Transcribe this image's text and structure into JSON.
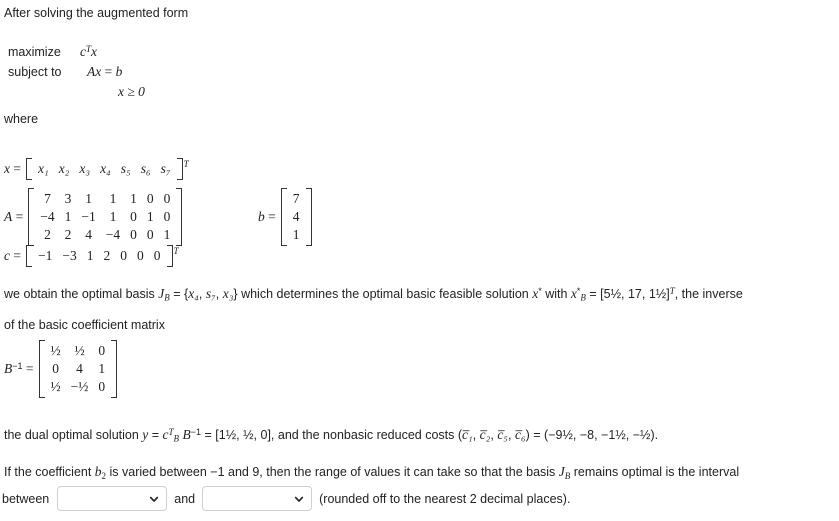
{
  "intro": "After solving the augmented form",
  "problem": {
    "maximize_label": "maximize",
    "maximize_expr_c": "c",
    "maximize_expr_T": "T",
    "maximize_expr_x": "x",
    "subject_label": "subject to",
    "constraint_A": "Ax",
    "constraint_eq": "=",
    "constraint_b": "b",
    "nonneg": "x ≥ 0",
    "where_label": "where"
  },
  "definitions": {
    "x_label": "x",
    "x_eq": "=",
    "x_entries": [
      "x₁",
      "x₂",
      "x₃",
      "x₄",
      "s₅",
      "s₆",
      "s₇"
    ],
    "x_transpose": "T",
    "A_label": "A",
    "A_eq": "=",
    "A_rows": [
      [
        "7",
        "3",
        "1",
        "1",
        "1",
        "0",
        "0"
      ],
      [
        "−4",
        "1",
        "−1",
        "1",
        "0",
        "1",
        "0"
      ],
      [
        "2",
        "2",
        "4",
        "−4",
        "0",
        "0",
        "1"
      ]
    ],
    "b_label": "b",
    "b_eq": "=",
    "b_rows": [
      [
        "7"
      ],
      [
        "4"
      ],
      [
        "1"
      ]
    ],
    "c_label": "c",
    "c_eq": "=",
    "c_entries": [
      "−1",
      "−3",
      "1",
      "2",
      "0",
      "0",
      "0"
    ],
    "c_transpose": "T"
  },
  "basis_paragraph": {
    "seg1": "we obtain the optimal basis ",
    "J": "J",
    "J_sub": "B",
    "eq1": " = {",
    "basis_elements": [
      "x₄",
      "s₇",
      "x₃"
    ],
    "seg2": "} which determines the optimal basic feasible solution ",
    "xstar": "x",
    "xstar_sup": "*",
    "seg3": " with ",
    "xB": "x",
    "xB_sup": "*",
    "xB_sub": "B",
    "eq2": " = [",
    "xB_values": [
      "5½",
      "17",
      "1½"
    ],
    "xB_close": "]",
    "xB_T": "T",
    "seg4": ", the inverse",
    "seg5": "of the basic coefficient matrix"
  },
  "binv": {
    "label_B": "B",
    "label_exp": "−1",
    "label_eq": "=",
    "rows": [
      [
        "½",
        "½",
        "0"
      ],
      [
        "0",
        "4",
        "1"
      ],
      [
        "½",
        "−½",
        "0"
      ]
    ]
  },
  "dual_paragraph": {
    "seg1": "the dual optimal solution ",
    "y": "y",
    "eq1": " = ",
    "c": "c",
    "c_sup": "T",
    "c_sub": "B",
    "B": "B",
    "B_sup": "−1",
    "eq2": " = [",
    "y_values": [
      "1½",
      "½",
      "0"
    ],
    "close": "],",
    "seg2": " and the nonbasic reduced costs (",
    "reduced_cost_labels": [
      "c̅₁",
      "c̅₂",
      "c̅₅",
      "c̅₆"
    ],
    "eq3": ") = (",
    "reduced_cost_values": [
      "−9½",
      "−8",
      "−1½",
      "−½"
    ],
    "end": ")."
  },
  "question": {
    "seg1": "If the coefficient ",
    "b": "b",
    "b_sub": "2",
    "seg2": " is varied between −1 and 9, then the range of values it can take so that the basis ",
    "J": "J",
    "J_sub": "B",
    "seg3": " remains optimal is the interval",
    "between_label": "between",
    "and_label": "and",
    "suffix": "(rounded off to the nearest 2 decimal places).",
    "lower_select_value": "",
    "upper_select_value": "",
    "lower_select_options": [
      ""
    ],
    "upper_select_options": [
      ""
    ],
    "chevron_icon": "chevron-down-icon"
  },
  "colors": {
    "text": "#222222",
    "border": "#cfcfcf",
    "bracket": "#333333"
  }
}
